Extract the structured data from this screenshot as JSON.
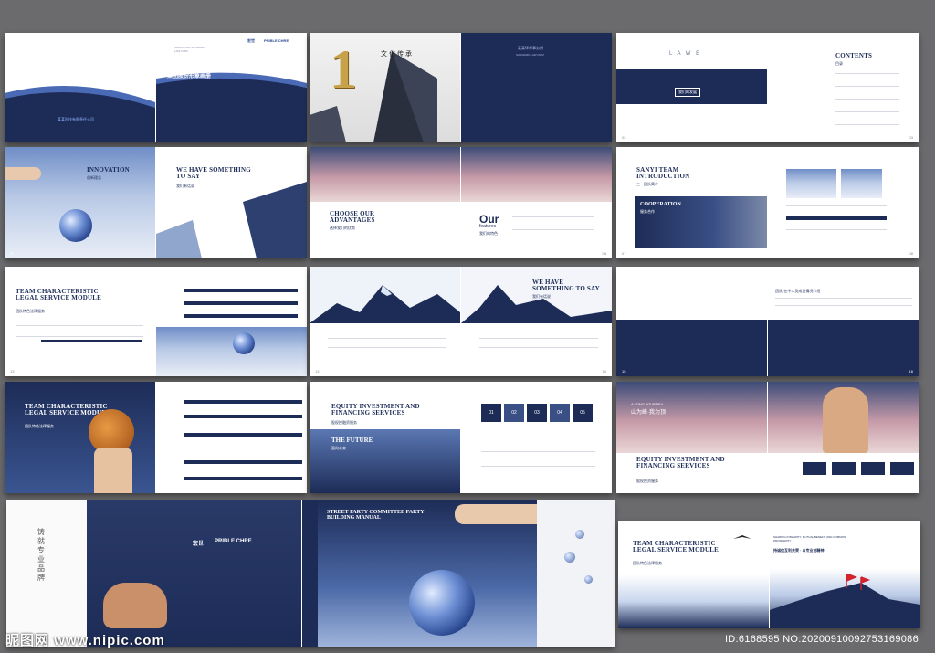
{
  "spread1": {
    "title_cn": "集团股份形象画册",
    "company_cn": "某某科技有限责任公司",
    "en_small": "SHANDONG SUNWARD LAW FIRM",
    "brand_left": "宏世",
    "brand_right": "PRIBLE CHRE"
  },
  "spread2": {
    "big_number": "1",
    "seal_text": "文化传承",
    "right_cn": "某某律师事务所",
    "right_en": "SUNWARD LAW FIRM"
  },
  "spread3": {
    "lawe": "L A W E",
    "contents": "CONTENTS",
    "contents_cn": "目录",
    "box_label": "我们的发展",
    "page_l": "02",
    "page_r": "03"
  },
  "spread4": {
    "innovation": "INNOVATION",
    "innovation_cn": "创新理念",
    "we_have": "WE HAVE SOMETHING TO SAY",
    "we_have_cn": "我们有话说",
    "page_l": "07"
  },
  "spread5": {
    "choose": "CHOOSE OUR ADVANTAGES",
    "choose_cn": "选择我们的优势",
    "our": "Our",
    "features": "features",
    "features_cn": "我们的特色",
    "page_r": "08"
  },
  "spread6": {
    "sanyi": "SANYI TEAM INTRODUCTION",
    "sanyi_cn": "三一团队简介",
    "cooperation": "COOPERATION",
    "coop_cn": "服务合作",
    "page_l": "07",
    "page_r": "08"
  },
  "spread7": {
    "team": "TEAM CHARACTERISTIC LEGAL SERVICE MODULE",
    "team_cn": "团队特色法律服务",
    "page_l": "13"
  },
  "spread8": {
    "we_have": "WE HAVE SOMETHING TO SAY",
    "we_have_cn": "我们有话说",
    "page_l": "13",
    "page_r": "14"
  },
  "spread9": {
    "intro_cn": "团队·在中人员成员情况介绍",
    "page_l": "15",
    "page_r": "16"
  },
  "spread10": {
    "team": "TEAM CHARACTERISTIC LEGAL SERVICE MODULE",
    "team_cn": "团队特色法律服务"
  },
  "spread11": {
    "equity": "EQUITY INVESTMENT AND FINANCING SERVICES",
    "equity_cn": "股权投融资服务",
    "future": "THE FUTURE",
    "future_cn": "面向未来",
    "steps": [
      "01",
      "02",
      "03",
      "04",
      "05"
    ]
  },
  "spread12": {
    "journey": "A LONG JOURNEY",
    "journey_cn": "山为峰·我为顶",
    "equity": "EQUITY INVESTMENT AND FINANCING SERVICES",
    "equity_cn": "股权投资服务"
  },
  "spread13": {
    "brand_left": "宏世",
    "brand_right": "PRIBLE CHRE",
    "vertical_cn": "铸就专业品牌",
    "party": "STREET PARTY COMMITTEE PARTY BUILDING MANUAL"
  },
  "spread14": {
    "team": "TEAM CHARACTERISTIC LEGAL SERVICE MODULE",
    "team_cn": "团队特色法律服务",
    "slogan_cn": "持诚信互利共荣 · 以专业创精神",
    "en_slogan": "SHARING INTEGRITY, MUTUAL BENEFIT AND COMMON PROSPERITY"
  },
  "watermark": {
    "left": "昵图网 www.nipic.com",
    "right": "ID:6168595 NO:20200910092753169086"
  }
}
